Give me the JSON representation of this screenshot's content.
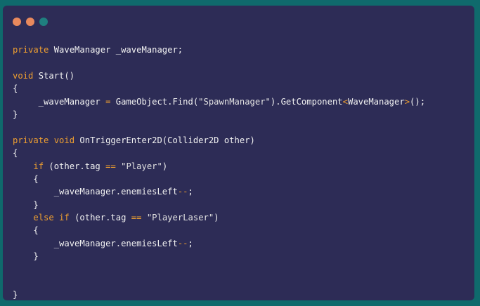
{
  "window": {
    "traffic_lights": [
      {
        "name": "close",
        "color": "#e8895d"
      },
      {
        "name": "minimize",
        "color": "#e8895d"
      },
      {
        "name": "maximize",
        "color": "#1f7f7f"
      }
    ],
    "colors": {
      "background": "#2d2c56",
      "page_background": "#0f6a6c",
      "keyword": "#f0a030",
      "default": "#f2f2f2",
      "string": "#e2e2e2"
    }
  },
  "code": {
    "lines": [
      [
        {
          "t": "private",
          "c": "kw"
        },
        {
          "t": " WaveManager _waveManager;",
          "c": "df"
        }
      ],
      [],
      [
        {
          "t": "void",
          "c": "kw"
        },
        {
          "t": " Start()",
          "c": "df"
        }
      ],
      [
        {
          "t": "{",
          "c": "df"
        }
      ],
      [
        {
          "t": "     _waveManager ",
          "c": "df"
        },
        {
          "t": "=",
          "c": "kw"
        },
        {
          "t": " GameObject.Find(",
          "c": "df"
        },
        {
          "t": "\"SpawnManager\"",
          "c": "str"
        },
        {
          "t": ").GetComponent",
          "c": "df"
        },
        {
          "t": "<",
          "c": "kw"
        },
        {
          "t": "WaveManager",
          "c": "df"
        },
        {
          "t": ">",
          "c": "kw"
        },
        {
          "t": "();",
          "c": "df"
        }
      ],
      [
        {
          "t": "}",
          "c": "df"
        }
      ],
      [],
      [
        {
          "t": "private void",
          "c": "kw"
        },
        {
          "t": " OnTriggerEnter2D(Collider2D other)",
          "c": "df"
        }
      ],
      [
        {
          "t": "{",
          "c": "df"
        }
      ],
      [
        {
          "t": "    ",
          "c": "df"
        },
        {
          "t": "if",
          "c": "kw"
        },
        {
          "t": " (other.tag ",
          "c": "df"
        },
        {
          "t": "==",
          "c": "kw"
        },
        {
          "t": " ",
          "c": "df"
        },
        {
          "t": "\"Player\"",
          "c": "str"
        },
        {
          "t": ")",
          "c": "df"
        }
      ],
      [
        {
          "t": "    {",
          "c": "df"
        }
      ],
      [
        {
          "t": "        _waveManager.enemiesLeft",
          "c": "df"
        },
        {
          "t": "--",
          "c": "kw"
        },
        {
          "t": ";",
          "c": "df"
        }
      ],
      [
        {
          "t": "    }",
          "c": "df"
        }
      ],
      [
        {
          "t": "    ",
          "c": "df"
        },
        {
          "t": "else if",
          "c": "kw"
        },
        {
          "t": " (other.tag ",
          "c": "df"
        },
        {
          "t": "==",
          "c": "kw"
        },
        {
          "t": " ",
          "c": "df"
        },
        {
          "t": "\"PlayerLaser\"",
          "c": "str"
        },
        {
          "t": ")",
          "c": "df"
        }
      ],
      [
        {
          "t": "    {",
          "c": "df"
        }
      ],
      [
        {
          "t": "        _waveManager.enemiesLeft",
          "c": "df"
        },
        {
          "t": "--",
          "c": "kw"
        },
        {
          "t": ";",
          "c": "df"
        }
      ],
      [
        {
          "t": "    }",
          "c": "df"
        }
      ],
      [],
      [],
      [
        {
          "t": "}",
          "c": "df"
        }
      ]
    ]
  }
}
